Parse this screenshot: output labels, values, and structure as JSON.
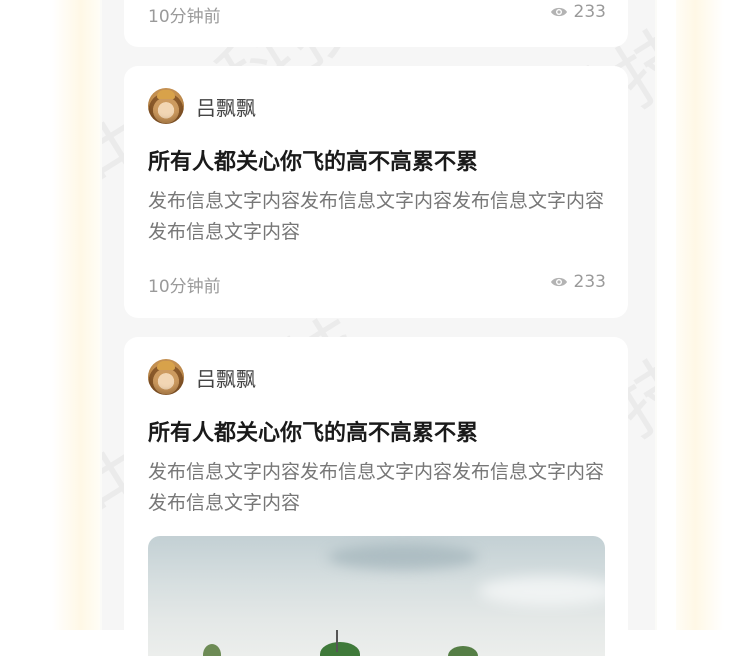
{
  "watermark": "中科科技",
  "posts": [
    {
      "time": "10分钟前",
      "views": "233"
    },
    {
      "author": "吕飘飘",
      "title": "所有人都关心你飞的高不高累不累",
      "body": "发布信息文字内容发布信息文字内容发布信息文字内容发布信息文字内容",
      "time": "10分钟前",
      "views": "233"
    },
    {
      "author": "吕飘飘",
      "title": "所有人都关心你飞的高不高累不累",
      "body": "发布信息文字内容发布信息文字内容发布信息文字内容发布信息文字内容",
      "image": "landscape-photo"
    }
  ]
}
